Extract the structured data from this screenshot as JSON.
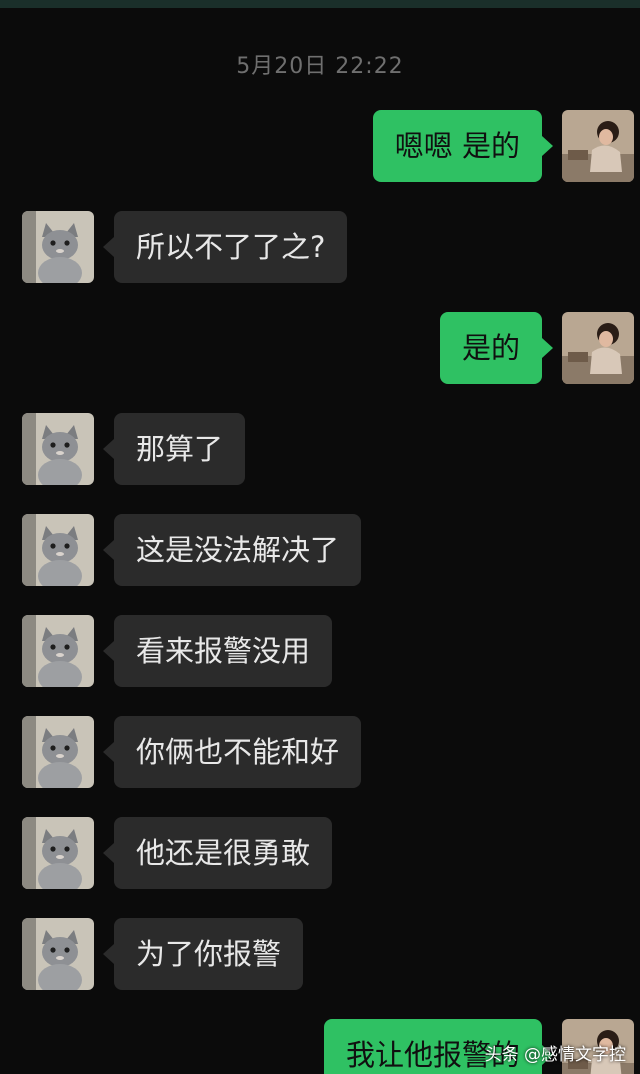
{
  "chat": {
    "timestamp": "5月20日 22:22",
    "messages": [
      {
        "side": "right",
        "text": "嗯嗯 是的"
      },
      {
        "side": "left",
        "text": "所以不了了之?"
      },
      {
        "side": "right",
        "text": "是的"
      },
      {
        "side": "left",
        "text": "那算了"
      },
      {
        "side": "left",
        "text": "这是没法解决了"
      },
      {
        "side": "left",
        "text": "看来报警没用"
      },
      {
        "side": "left",
        "text": "你俩也不能和好"
      },
      {
        "side": "left",
        "text": "他还是很勇敢"
      },
      {
        "side": "left",
        "text": "为了你报警"
      },
      {
        "side": "right",
        "text": "我让他报警的"
      }
    ]
  },
  "watermark": {
    "text": "头条 @感情文字控"
  },
  "colors": {
    "background": "#0b0b0b",
    "sent_bubble": "#2fc163",
    "received_bubble": "#2b2b2b",
    "timestamp_text": "#6f6f6f"
  },
  "icons": {
    "left_avatar": "gray-cat-avatar-icon",
    "right_avatar": "woman-photo-avatar-icon"
  }
}
